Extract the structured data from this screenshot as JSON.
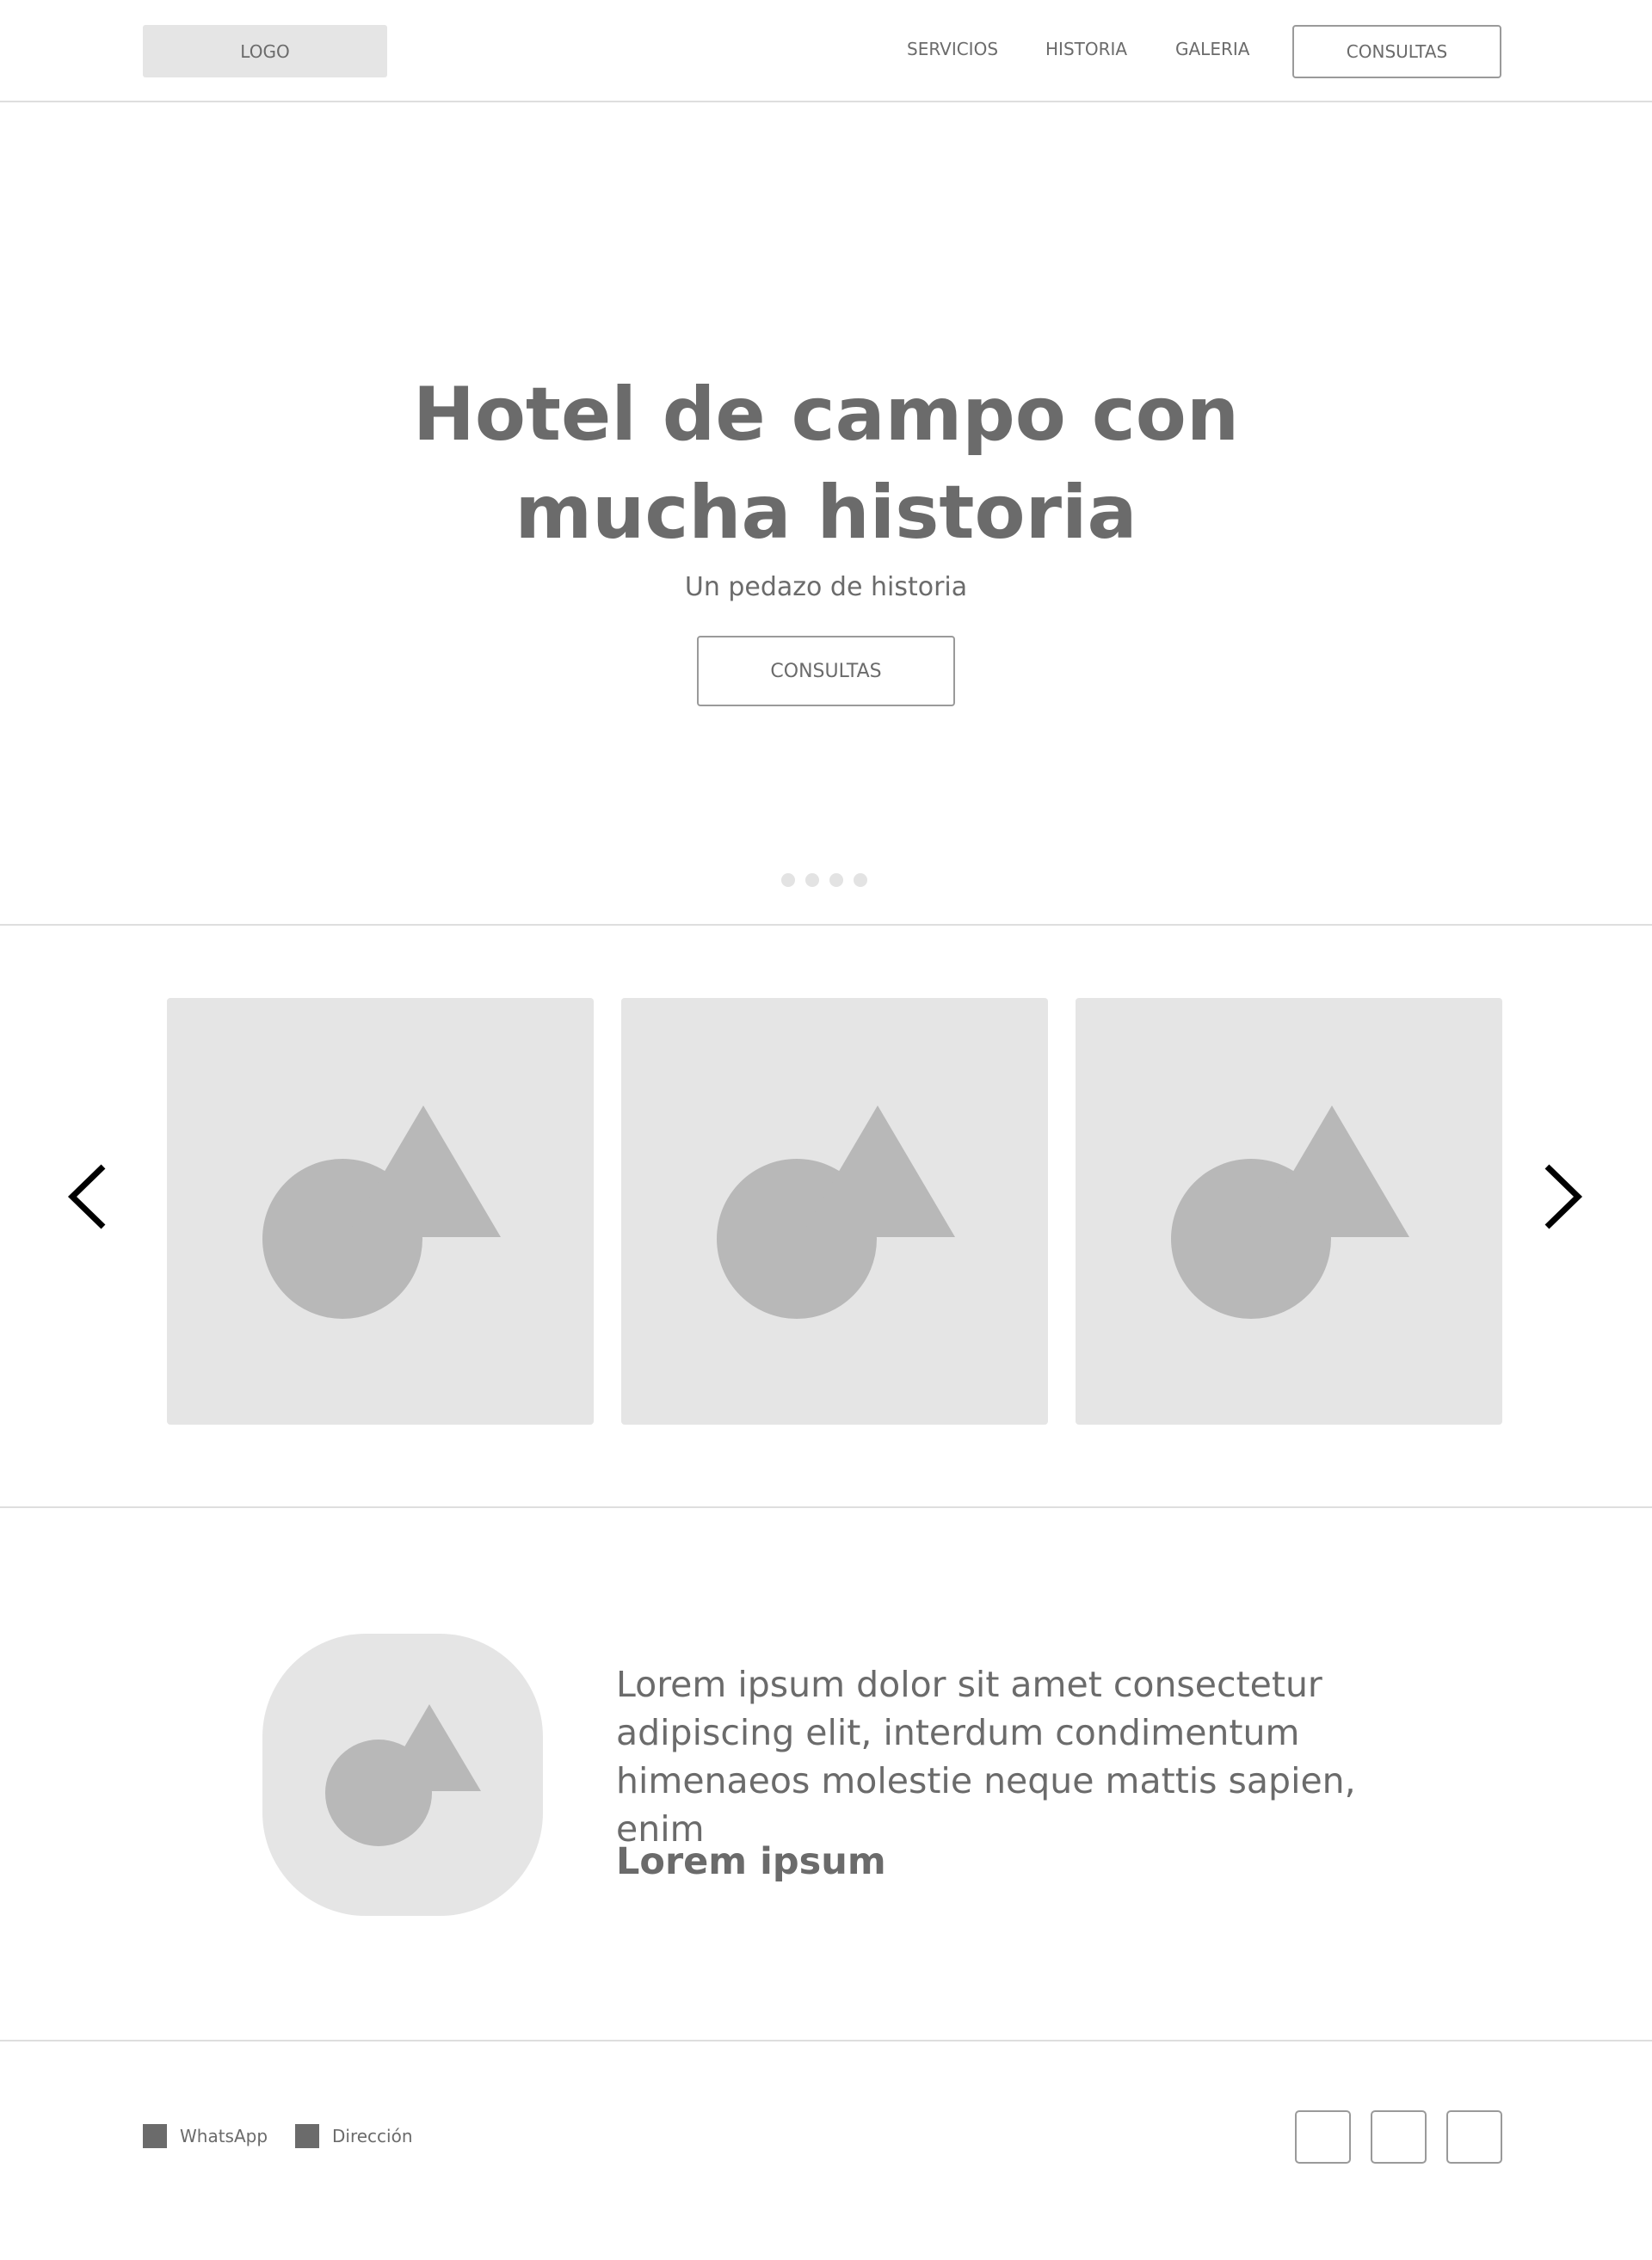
{
  "header": {
    "logo_label": "LOGO",
    "nav": [
      {
        "label": "SERVICIOS"
      },
      {
        "label": "HISTORIA"
      },
      {
        "label": "GALERIA"
      }
    ],
    "cta_label": "CONSULTAS"
  },
  "hero": {
    "title_line1": "Hotel de campo con",
    "title_line2": "mucha historia",
    "subtitle": "Un pedazo de historia",
    "cta_label": "CONSULTAS",
    "slides_count": 4
  },
  "gallery": {
    "items": [
      {
        "icon": "image-placeholder-icon"
      },
      {
        "icon": "image-placeholder-icon"
      },
      {
        "icon": "image-placeholder-icon"
      }
    ],
    "prev_icon": "chevron-left-icon",
    "next_icon": "chevron-right-icon"
  },
  "testimonial": {
    "avatar_icon": "image-placeholder-icon",
    "quote": "Lorem ipsum dolor sit amet consectetur adipiscing elit, interdum condimentum himenaeos molestie neque mattis sapien, enim",
    "author": "Lorem ipsum"
  },
  "footer": {
    "contacts": [
      {
        "label": "WhatsApp",
        "icon": "whatsapp-icon"
      },
      {
        "label": "Dirección",
        "icon": "location-icon"
      }
    ],
    "social_count": 3
  },
  "colors": {
    "text": "#6b6b6b",
    "placeholder_bg": "#e5e5e5",
    "placeholder_shape": "#b8b8b8",
    "divider": "#dedede",
    "border": "#9a9a9a"
  }
}
